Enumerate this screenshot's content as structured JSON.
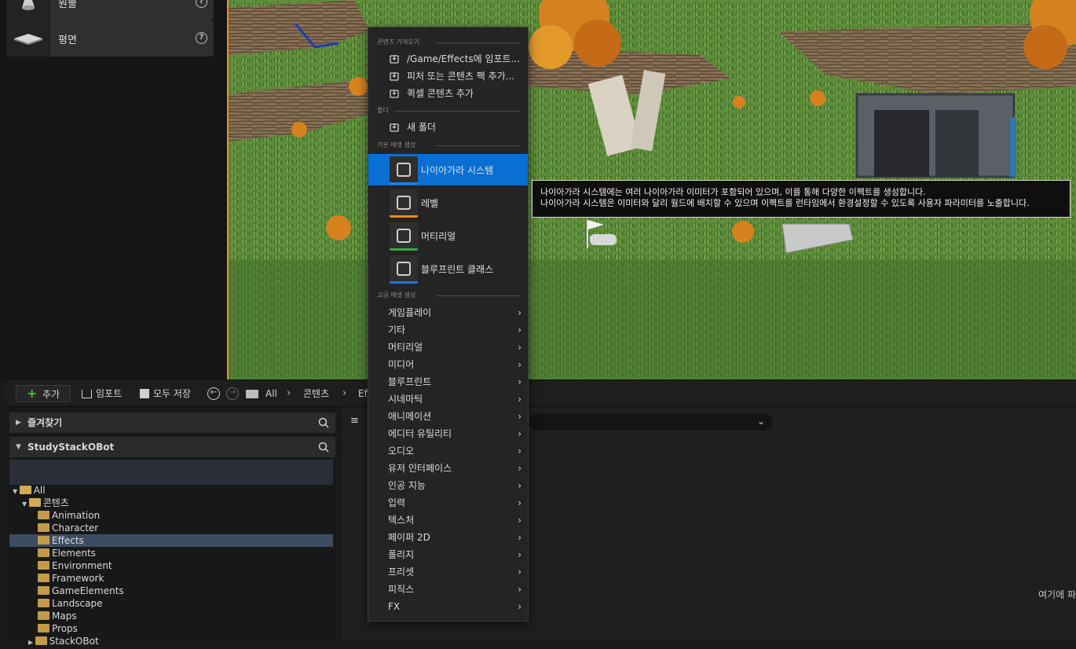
{
  "place_panel": {
    "items": [
      {
        "label": "원뿔",
        "icon": "cone-icon"
      },
      {
        "label": "평면",
        "icon": "plane-icon"
      }
    ]
  },
  "toolbar": {
    "add_label": "추가",
    "import_label": "임포트",
    "save_all_label": "모두 저장",
    "breadcrumb": [
      "All",
      "콘텐츠",
      "Effects"
    ]
  },
  "sources": {
    "favorites_label": "즐겨찾기",
    "project_label": "StudyStackOBot",
    "tree": [
      {
        "label": "All",
        "level": 0,
        "expanded": true
      },
      {
        "label": "콘텐츠",
        "level": 1,
        "expanded": true
      },
      {
        "label": "Animation",
        "level": 2
      },
      {
        "label": "Character",
        "level": 2
      },
      {
        "label": "Effects",
        "level": 2,
        "selected": true
      },
      {
        "label": "Elements",
        "level": 2
      },
      {
        "label": "Environment",
        "level": 2
      },
      {
        "label": "Framework",
        "level": 2
      },
      {
        "label": "GameElements",
        "level": 2
      },
      {
        "label": "Landscape",
        "level": 2
      },
      {
        "label": "Maps",
        "level": 2
      },
      {
        "label": "Props",
        "level": 2
      },
      {
        "label": "StackOBot",
        "level": 2,
        "collapsed_child": true
      }
    ]
  },
  "asset_view": {
    "drop_hint": "여기에 파"
  },
  "context_menu": {
    "sections": {
      "get_content": "콘텐츠 가져오기",
      "folder": "폴더",
      "basic_assets": "기본 에셋 생성",
      "advanced_assets": "고급 에셋 생성"
    },
    "get_content_items": [
      {
        "label": "/Game/Effects에 임포트...",
        "icon": "import-icon"
      },
      {
        "label": "피처 또는 콘텐츠 팩 추가...",
        "icon": "content-pack-icon"
      },
      {
        "label": "퀵셀 콘텐츠 추가",
        "icon": "quixel-icon"
      }
    ],
    "folder_items": [
      {
        "label": "새 폴더",
        "icon": "new-folder-icon"
      }
    ],
    "basic_assets": [
      {
        "label": "나이아가라 시스템",
        "icon": "niagara-system-icon",
        "color": "#1e7fe0",
        "highlighted": true
      },
      {
        "label": "레벨",
        "icon": "level-icon",
        "color": "#e8891a"
      },
      {
        "label": "머티리얼",
        "icon": "material-icon",
        "color": "#39a839"
      },
      {
        "label": "블루프린트 클래스",
        "icon": "blueprint-class-icon",
        "color": "#2a6fd6"
      }
    ],
    "advanced_assets": [
      "게임플레이",
      "기타",
      "머티리얼",
      "미디어",
      "블루프린트",
      "시네마틱",
      "애니메이션",
      "에디터 유틸리티",
      "오디오",
      "유저 인터페이스",
      "인공 지능",
      "입력",
      "텍스처",
      "페이퍼 2D",
      "폴리지",
      "프리셋",
      "피직스",
      "FX"
    ]
  },
  "tooltip": {
    "line1": "나이아가라 시스템에는 여러 나이아가라 이미터가 포함되어 있으며, 이를 통해 다양한 이펙트를 생성합니다.",
    "line2": "나이아가라 시스템은 이미터와 달리 월드에 배치할 수 있으며 이펙트를 런타임에서 환경설정할 수 있도록 사용자 파라미터를 노출합니다."
  },
  "colors": {
    "accent": "#0a6fd3",
    "viewport_border": "#d99a1c",
    "add_plus": "#3fbf3f"
  }
}
